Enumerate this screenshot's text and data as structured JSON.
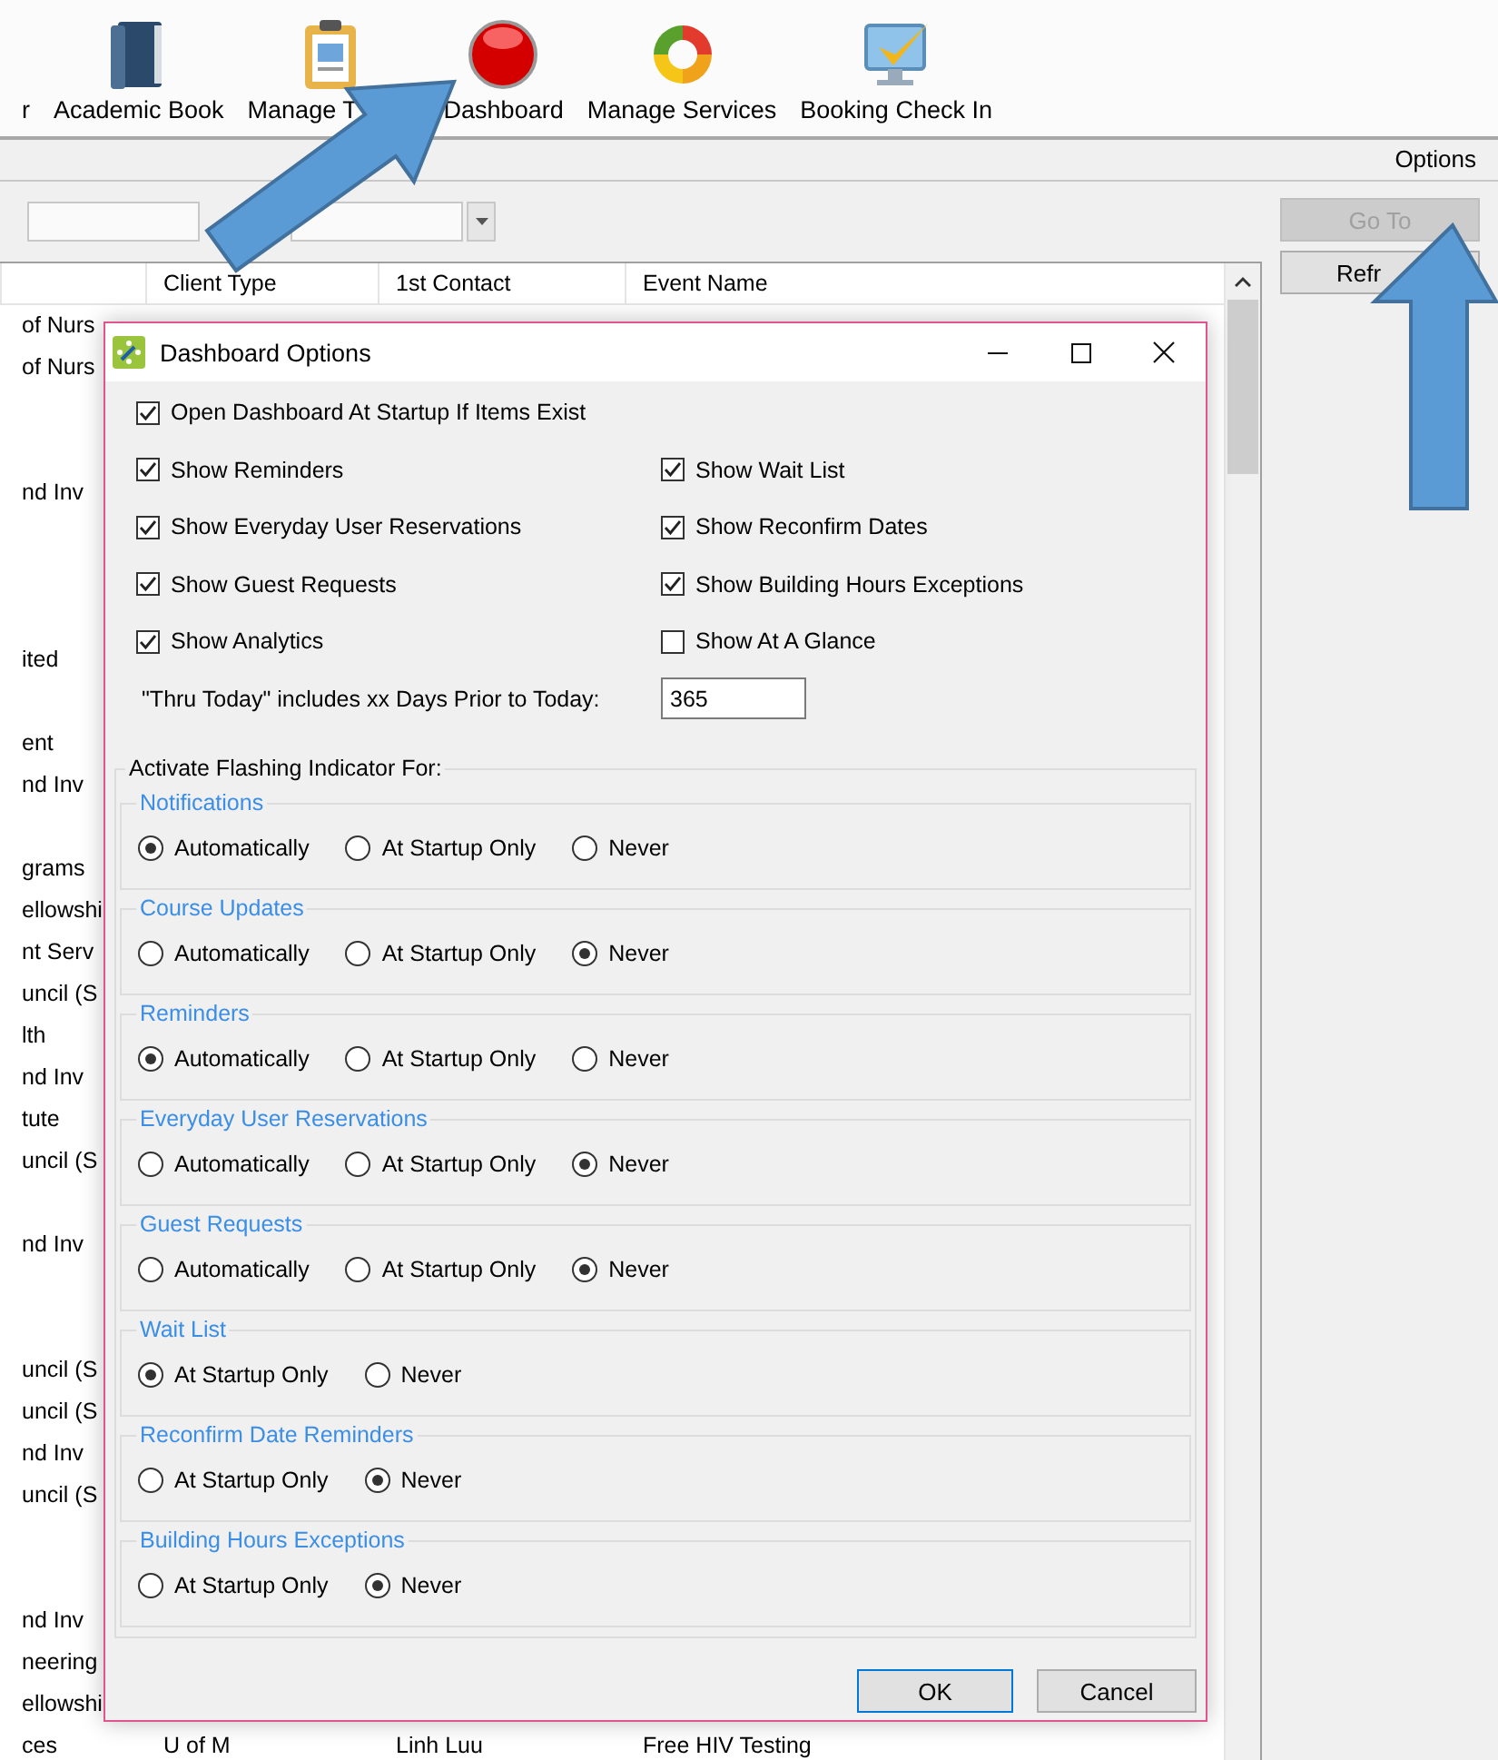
{
  "toolbar": {
    "items": [
      {
        "label": "r"
      },
      {
        "label": "Academic Book",
        "kind": "book"
      },
      {
        "label": "Manage T",
        "kind": "clipboard"
      },
      {
        "label": "Dashboard",
        "kind": "ball"
      },
      {
        "label": "Manage Services",
        "kind": "cycle"
      },
      {
        "label": "Booking Check In",
        "kind": "monitor"
      }
    ]
  },
  "options_bar": {
    "label": "Options"
  },
  "side_buttons": [
    {
      "label": "Go To",
      "disabled": true
    },
    {
      "label": "Refr",
      "disabled": false
    }
  ],
  "table": {
    "columns": [
      "Client Type",
      "1st Contact",
      "Event Name"
    ],
    "rows": [
      {
        "column_1": "of Nurs"
      },
      {
        "column_1": "of Nurs"
      },
      {},
      {},
      {
        "column_1": "nd Inv"
      },
      {},
      {},
      {},
      {
        "column_1": "ited"
      },
      {},
      {
        "column_1": "ent"
      },
      {
        "column_1": "nd Inv"
      },
      {},
      {
        "column_1": "grams"
      },
      {
        "column_1": "ellowshi"
      },
      {
        "column_1": "nt Serv"
      },
      {
        "column_1": "uncil (S"
      },
      {
        "column_1": "lth"
      },
      {
        "column_1": "nd Inv"
      },
      {
        "column_1": "tute"
      },
      {
        "column_1": "uncil (S"
      },
      {},
      {
        "column_1": "nd Inv"
      },
      {},
      {},
      {
        "column_1": "uncil (S"
      },
      {
        "column_1": "uncil (S"
      },
      {
        "column_1": "nd Inv"
      },
      {
        "column_1": "uncil (S"
      },
      {},
      {},
      {
        "column_1": "nd Inv"
      },
      {
        "column_1": "neering"
      },
      {
        "column_1": "ellowshi"
      },
      {
        "column_1": "ces",
        "client_type": "U of M",
        "first_contact": "Linh Luu",
        "event_name": "Free HIV Testing"
      }
    ]
  },
  "dialog": {
    "title": "Dashboard Options",
    "startup_option": {
      "label": "Open Dashboard At Startup If Items Exist",
      "checked": true
    },
    "show_options": [
      {
        "label": "Show Reminders",
        "checked": true
      },
      {
        "label": "Show Wait List",
        "checked": true
      },
      {
        "label": "Show Everyday User Reservations",
        "checked": true
      },
      {
        "label": "Show Reconfirm Dates",
        "checked": true
      },
      {
        "label": "Show Guest Requests",
        "checked": true
      },
      {
        "label": "Show Building Hours Exceptions",
        "checked": true
      },
      {
        "label": "Show Analytics",
        "checked": true
      },
      {
        "label": "Show At A Glance",
        "checked": false
      }
    ],
    "days_field": {
      "label": "\"Thru Today\" includes xx Days Prior to Today:",
      "value": "365"
    },
    "flashing": {
      "title": "Activate Flashing Indicator For:",
      "groups": [
        {
          "title": "Notifications",
          "choices": [
            {
              "label": "Automatically",
              "selected": true
            },
            {
              "label": "At Startup Only",
              "selected": false
            },
            {
              "label": "Never",
              "selected": false
            }
          ]
        },
        {
          "title": "Course Updates",
          "choices": [
            {
              "label": "Automatically",
              "selected": false
            },
            {
              "label": "At Startup Only",
              "selected": false
            },
            {
              "label": "Never",
              "selected": true
            }
          ]
        },
        {
          "title": "Reminders",
          "choices": [
            {
              "label": "Automatically",
              "selected": true
            },
            {
              "label": "At Startup Only",
              "selected": false
            },
            {
              "label": "Never",
              "selected": false
            }
          ]
        },
        {
          "title": "Everyday User Reservations",
          "choices": [
            {
              "label": "Automatically",
              "selected": false
            },
            {
              "label": "At Startup Only",
              "selected": false
            },
            {
              "label": "Never",
              "selected": true
            }
          ]
        },
        {
          "title": "Guest Requests",
          "choices": [
            {
              "label": "Automatically",
              "selected": false
            },
            {
              "label": "At Startup Only",
              "selected": false
            },
            {
              "label": "Never",
              "selected": true
            }
          ]
        },
        {
          "title": "Wait List",
          "choices": [
            {
              "label": "At Startup Only",
              "selected": true
            },
            {
              "label": "Never",
              "selected": false
            }
          ]
        },
        {
          "title": "Reconfirm Date Reminders",
          "choices": [
            {
              "label": "At Startup Only",
              "selected": false
            },
            {
              "label": "Never",
              "selected": true
            }
          ]
        },
        {
          "title": "Building Hours Exceptions",
          "choices": [
            {
              "label": "At Startup Only",
              "selected": false
            },
            {
              "label": "Never",
              "selected": true
            }
          ]
        }
      ]
    },
    "buttons": [
      "OK",
      "Cancel"
    ]
  }
}
